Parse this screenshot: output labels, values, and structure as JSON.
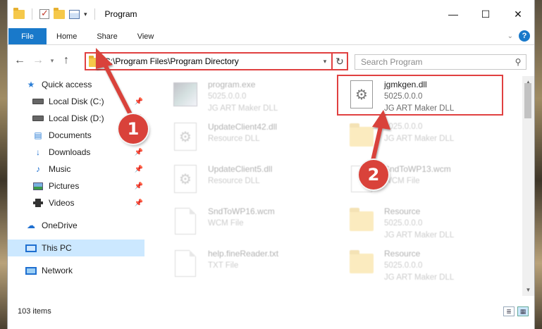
{
  "window": {
    "title": "Program",
    "controls": {
      "minimize": "—",
      "maximize": "☐",
      "close": "✕"
    }
  },
  "ribbon": {
    "tabs": [
      {
        "label": "File"
      },
      {
        "label": "Home"
      },
      {
        "label": "Share"
      },
      {
        "label": "View"
      }
    ]
  },
  "address": {
    "path": "C:\\Program Files\\Program Directory"
  },
  "search": {
    "placeholder": "Search Program"
  },
  "sidebar": {
    "items": [
      {
        "label": "Quick access"
      },
      {
        "label": "Local Disk (C:)"
      },
      {
        "label": "Local Disk (D:)"
      },
      {
        "label": "Documents"
      },
      {
        "label": "Downloads"
      },
      {
        "label": "Music"
      },
      {
        "label": "Pictures"
      },
      {
        "label": "Videos"
      },
      {
        "label": "OneDrive"
      },
      {
        "label": "This PC"
      },
      {
        "label": "Network"
      }
    ]
  },
  "files": [
    {
      "name": "program.exe",
      "line2": "5025.0.0.0",
      "line3": "JG ART Maker DLL"
    },
    {
      "name": "jgmkgen.dll",
      "line2": "5025.0.0.0",
      "line3": "JG ART Maker DLL"
    },
    {
      "name": "UpdateClient42.dll",
      "line2": "Resource DLL"
    },
    {
      "name": "",
      "line2": "5025.0.0.0",
      "line3": "JG ART Maker DLL"
    },
    {
      "name": "UpdateClient5.dll",
      "line2": "Resource DLL"
    },
    {
      "name": "SndToWP13.wcm",
      "line2": "WCM File"
    },
    {
      "name": "SndToWP16.wcm",
      "line2": "WCM File"
    },
    {
      "name": "Resource",
      "line2": "5025.0.0.0",
      "line3": "JG ART Maker DLL"
    },
    {
      "name": "help.fineReader.txt",
      "line2": "TXT File"
    },
    {
      "name": "Resource",
      "line2": "5025.0.0.0",
      "line3": "JG ART Maker DLL"
    }
  ],
  "status": {
    "item_count": "103 items"
  },
  "callouts": {
    "one": "1",
    "two": "2"
  }
}
